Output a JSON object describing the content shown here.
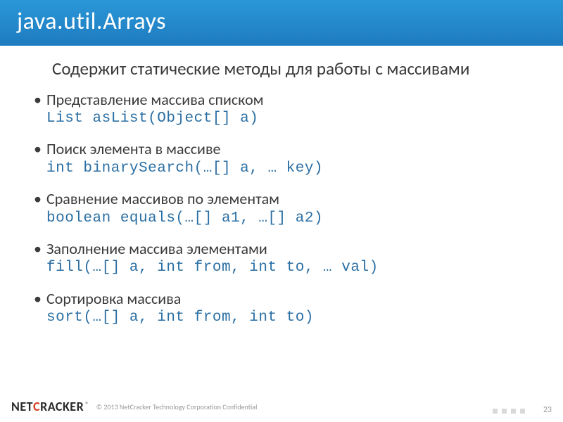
{
  "title": "java.util.Arrays",
  "intro": "Содержит статические методы для работы с массивами",
  "bullets": [
    {
      "text": "Представление массива списком",
      "code": "List asList(Object[] a)"
    },
    {
      "text": "Поиск элемента в массиве",
      "code": "int binarySearch(…[] a, … key)"
    },
    {
      "text": "Сравнение массивов по элементам",
      "code": "boolean equals(…[] a1, …[] a2)"
    },
    {
      "text": "Заполнение массива элементами",
      "code": "fill(…[] a, int from, int to, … val)"
    },
    {
      "text": "Сортировка массива",
      "code": "sort(…[] a, int from, int to)"
    }
  ],
  "footer": {
    "logo_net": "NET",
    "logo_c": "C",
    "logo_racker": "RACKER",
    "reg": "®",
    "copyright": "© 2013 NetCracker Technology Corporation Confidential"
  },
  "pagenum": "23"
}
